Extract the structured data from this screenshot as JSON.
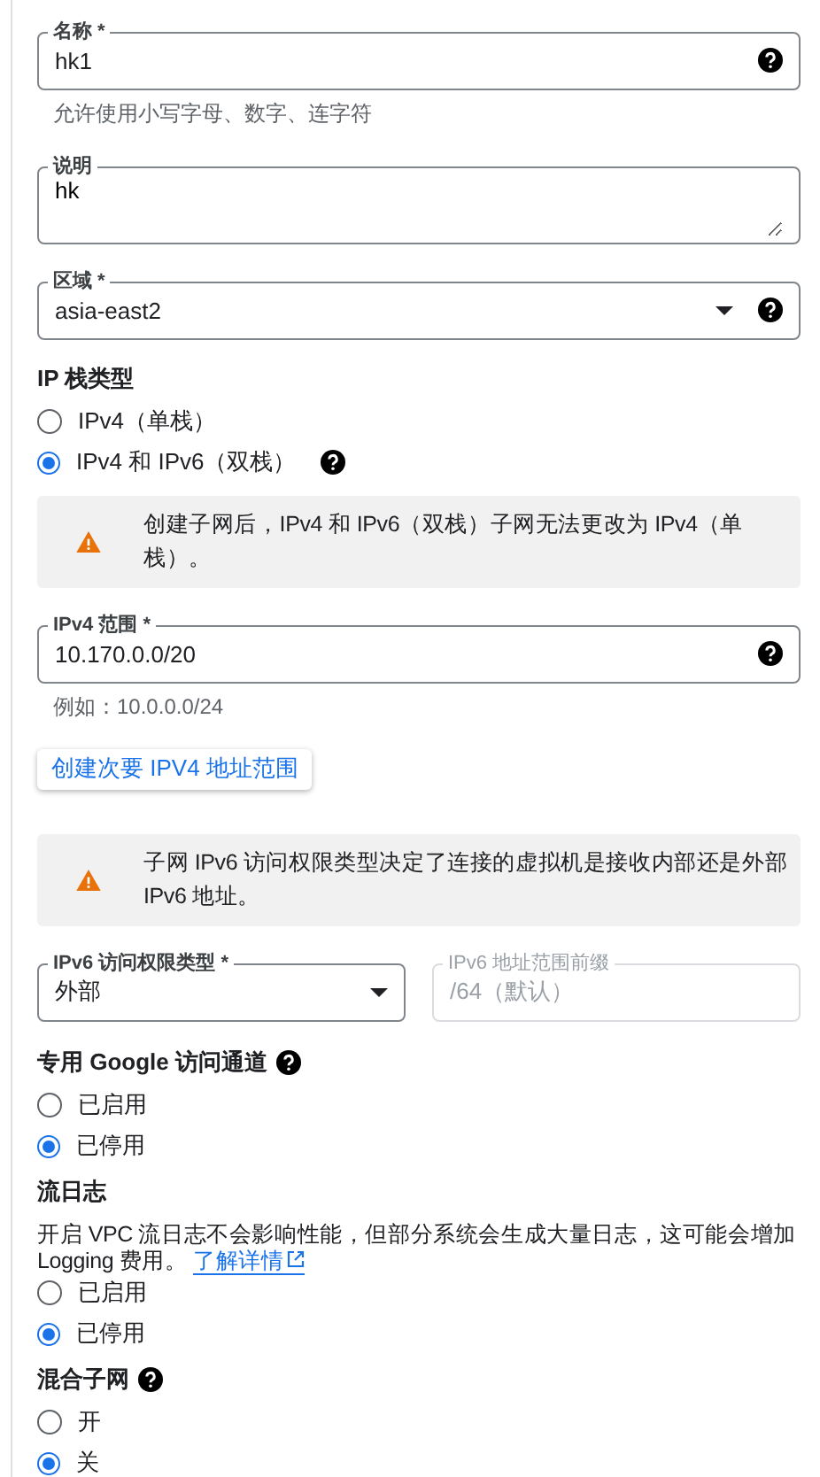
{
  "items": [
    {
      "kind": "field",
      "label": "名称 *",
      "value": "hk1",
      "help": true,
      "dropdown": false,
      "hint": "允许使用小写字母、数字、连字符"
    },
    {
      "kind": "textarea",
      "label": "说明",
      "value": "hk"
    },
    {
      "kind": "field",
      "label": "区域 *",
      "value": "asia-east2",
      "help": true,
      "dropdown": true
    },
    {
      "kind": "radio_group",
      "title": "IP 栈类型",
      "help": false,
      "options": [
        {
          "label": "IPv4（单栈）",
          "selected": false,
          "help": false
        },
        {
          "label": "IPv4 和 IPv6（双栈）",
          "selected": true,
          "help": true
        }
      ]
    },
    {
      "kind": "notice",
      "text": "创建子网后，IPv4 和 IPv6（双栈）子网无法更改为 IPv4（单栈）。"
    },
    {
      "kind": "field",
      "label": "IPv4 范围 *",
      "value": "10.170.0.0/20",
      "help": true,
      "dropdown": false,
      "hint": "例如：10.0.0.0/24"
    },
    {
      "kind": "button",
      "label": "创建次要 IPV4 地址范围"
    },
    {
      "kind": "notice",
      "text": "子网 IPv6 访问权限类型决定了连接的虚拟机是接收内部还是外部 IPv6 地址。"
    },
    {
      "kind": "field_pair",
      "fields": [
        {
          "label": "IPv6 访问权限类型 *",
          "value": "外部",
          "dropdown": true,
          "disabled": false
        },
        {
          "label": "IPv6 地址范围前缀",
          "value": "/64（默认）",
          "dropdown": false,
          "disabled": true
        }
      ]
    },
    {
      "kind": "radio_group",
      "title": "专用 Google 访问通道",
      "help": true,
      "options": [
        {
          "label": "已启用",
          "selected": false,
          "help": false
        },
        {
          "label": "已停用",
          "selected": true,
          "help": false
        }
      ]
    },
    {
      "kind": "radio_group",
      "title": "流日志",
      "help": false,
      "description": "开启 VPC 流日志不会影响性能，但部分系统会生成大量日志，这可能会增加 Logging 费用。",
      "link": "了解详情",
      "options": [
        {
          "label": "已启用",
          "selected": false,
          "help": false
        },
        {
          "label": "已停用",
          "selected": true,
          "help": false
        }
      ]
    },
    {
      "kind": "radio_group",
      "title": "混合子网",
      "help": true,
      "options": [
        {
          "label": "开",
          "selected": false,
          "help": false
        },
        {
          "label": "关",
          "selected": true,
          "help": false
        }
      ]
    }
  ]
}
